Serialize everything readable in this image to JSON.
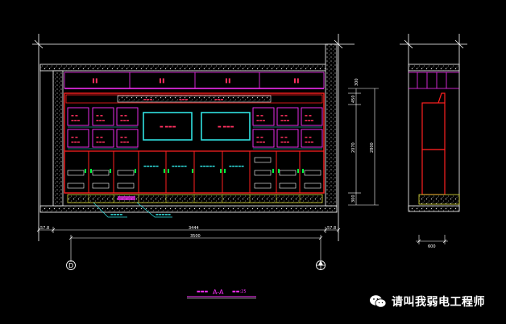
{
  "colors": {
    "background": "#000000",
    "frame": "#ffffff",
    "cabinet": "#ff2020",
    "shelf": "#ff30ff",
    "screen": "#30e0e0",
    "accent": "#00ff40",
    "dimension": "#ffffff",
    "hatch": "#e0e0e0"
  },
  "drawing": {
    "section_title": "A-A",
    "axis_left": "D",
    "watermark": "请叫我弱电工程师",
    "dims": {
      "overall_width_inner": "3444",
      "overall_width": "3500",
      "left_wall": "57.8",
      "right_wall": "57.8",
      "side_depth": "600",
      "height_total": "2800",
      "height_middle": "2070",
      "height_top": "300",
      "height_mid_a": "450",
      "height_bottom": "300"
    }
  }
}
